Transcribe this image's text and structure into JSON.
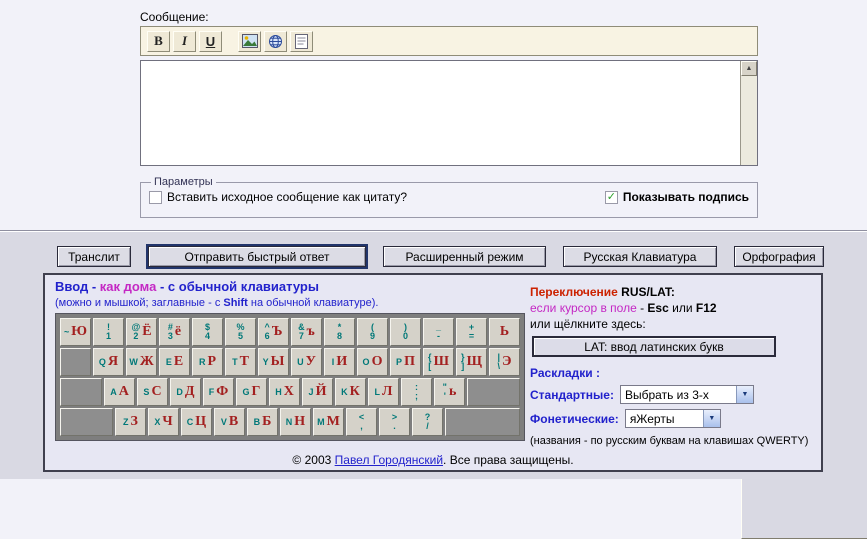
{
  "colors": {
    "accent_blue": "#2222cc",
    "magenta": "#c428c4",
    "red": "#cc2200",
    "latin_teal": "#007878",
    "russian_red": "#a32020",
    "check_green": "#2aa02a"
  },
  "icons": {
    "check": "✓",
    "dropdown_arrow": "▼",
    "scroll_up": "▲",
    "scroll_down": "▼"
  },
  "message": {
    "label": "Сообщение:",
    "toolbar": {
      "bold": "B",
      "italic": "I",
      "underline": "U"
    },
    "textarea_value": ""
  },
  "params": {
    "legend": "Параметры",
    "quote_checkbox": {
      "label": "Вставить исходное сообщение как цитату?",
      "checked": false
    },
    "signature_checkbox": {
      "label": "Показывать подпись",
      "checked": true
    }
  },
  "actions": [
    {
      "label": "Транслит"
    },
    {
      "label": "Отправить быстрый ответ",
      "default": true
    },
    {
      "label": "Расширенный режим"
    },
    {
      "label": "Русская Клавиатура"
    },
    {
      "label": "Орфография"
    }
  ],
  "panel": {
    "heading_parts": [
      {
        "t": "Ввод",
        "c": "c-blue"
      },
      {
        "t": " - ",
        "c": "c-blue"
      },
      {
        "t": "как дома",
        "c": "c-magenta"
      },
      {
        "t": " - ",
        "c": "c-blue"
      },
      {
        "t": "с обычной ",
        "c": "c-blue"
      },
      {
        "t": "клавиатуры",
        "c": "c-blue"
      }
    ],
    "subheading_parts": [
      {
        "t": "(можно и мышкой; заглавные - с "
      },
      {
        "t": "Shift",
        "c": "b"
      },
      {
        "t": " на обычной клавиатуре)."
      }
    ],
    "switching": {
      "line1_parts": [
        {
          "t": "Переключение ",
          "c": "c-red b"
        },
        {
          "t": "RUS/LAT:",
          "c": "b"
        }
      ],
      "line2_parts": [
        {
          "t": "если курсор в поле",
          "c": "c-magenta"
        },
        {
          "t": " - "
        },
        {
          "t": "Esc",
          "c": "b"
        },
        {
          "t": " или "
        },
        {
          "t": "F12",
          "c": "b"
        }
      ],
      "line3": "или щёлкните здесь:",
      "lat_button": "LAT: ввод латинских букв"
    },
    "layouts": {
      "title": "Раскладки :",
      "standard_label": "Стандартные:",
      "standard_value": "Выбрать из 3-х",
      "phonetic_label": "Фонетические:",
      "phonetic_value": "яЖерты",
      "note": "(названия - по русским буквам на клавишах QWERTY)"
    },
    "footer_parts": [
      {
        "t": "© 2003 "
      },
      {
        "t": "Павел Городянский",
        "c": "link",
        "n": "author-link",
        "i": true
      },
      {
        "t": ". Все права защищены."
      }
    ],
    "keyboard": {
      "rows": [
        [
          {
            "l": "~",
            "r": "Ю"
          },
          {
            "l": "!\n1"
          },
          {
            "l": "@\n2",
            "r": "Ё"
          },
          {
            "l": "#\n3",
            "r": "ё"
          },
          {
            "l": "$\n4"
          },
          {
            "l": "%\n5"
          },
          {
            "l": "^\n6",
            "r": "Ъ"
          },
          {
            "l": "&\n7",
            "r": "ъ"
          },
          {
            "l": "*\n8"
          },
          {
            "l": "(\n9"
          },
          {
            "l": ")\n0"
          },
          {
            "l": "_\n-"
          },
          {
            "l": "+\n="
          },
          {
            "r": "Ь"
          }
        ],
        [
          {
            "b": true,
            "w": 1
          },
          {
            "l": "Q",
            "r": "Я"
          },
          {
            "l": "W",
            "r": "Ж"
          },
          {
            "l": "E",
            "r": "Е"
          },
          {
            "l": "R",
            "r": "Р"
          },
          {
            "l": "T",
            "r": "Т"
          },
          {
            "l": "Y",
            "r": "Ы"
          },
          {
            "l": "U",
            "r": "У"
          },
          {
            "l": "I",
            "r": "И"
          },
          {
            "l": "O",
            "r": "О"
          },
          {
            "l": "P",
            "r": "П"
          },
          {
            "l": "{\n[",
            "r": "Ш"
          },
          {
            "l": "}\n]",
            "r": "Щ"
          },
          {
            "l": "|\n\\",
            "r": "Э"
          }
        ],
        [
          {
            "b": true,
            "w": 1.35
          },
          {
            "l": "A",
            "r": "А"
          },
          {
            "l": "S",
            "r": "С"
          },
          {
            "l": "D",
            "r": "Д"
          },
          {
            "l": "F",
            "r": "Ф"
          },
          {
            "l": "G",
            "r": "Г"
          },
          {
            "l": "H",
            "r": "Х"
          },
          {
            "l": "J",
            "r": "Й"
          },
          {
            "l": "K",
            "r": "К"
          },
          {
            "l": "L",
            "r": "Л"
          },
          {
            "l": ":\n;"
          },
          {
            "l": "\"\n'",
            "r": "ь"
          },
          {
            "b": true,
            "fill": true
          }
        ],
        [
          {
            "b": true,
            "w": 1.7
          },
          {
            "l": "Z",
            "r": "З"
          },
          {
            "l": "X",
            "r": "Ч"
          },
          {
            "l": "C",
            "r": "Ц"
          },
          {
            "l": "V",
            "r": "В"
          },
          {
            "l": "B",
            "r": "Б"
          },
          {
            "l": "N",
            "r": "Н"
          },
          {
            "l": "M",
            "r": "М"
          },
          {
            "l": "<\n,"
          },
          {
            "l": ">\n."
          },
          {
            "l": "?\n/"
          },
          {
            "b": true,
            "fill": true
          }
        ]
      ]
    }
  }
}
